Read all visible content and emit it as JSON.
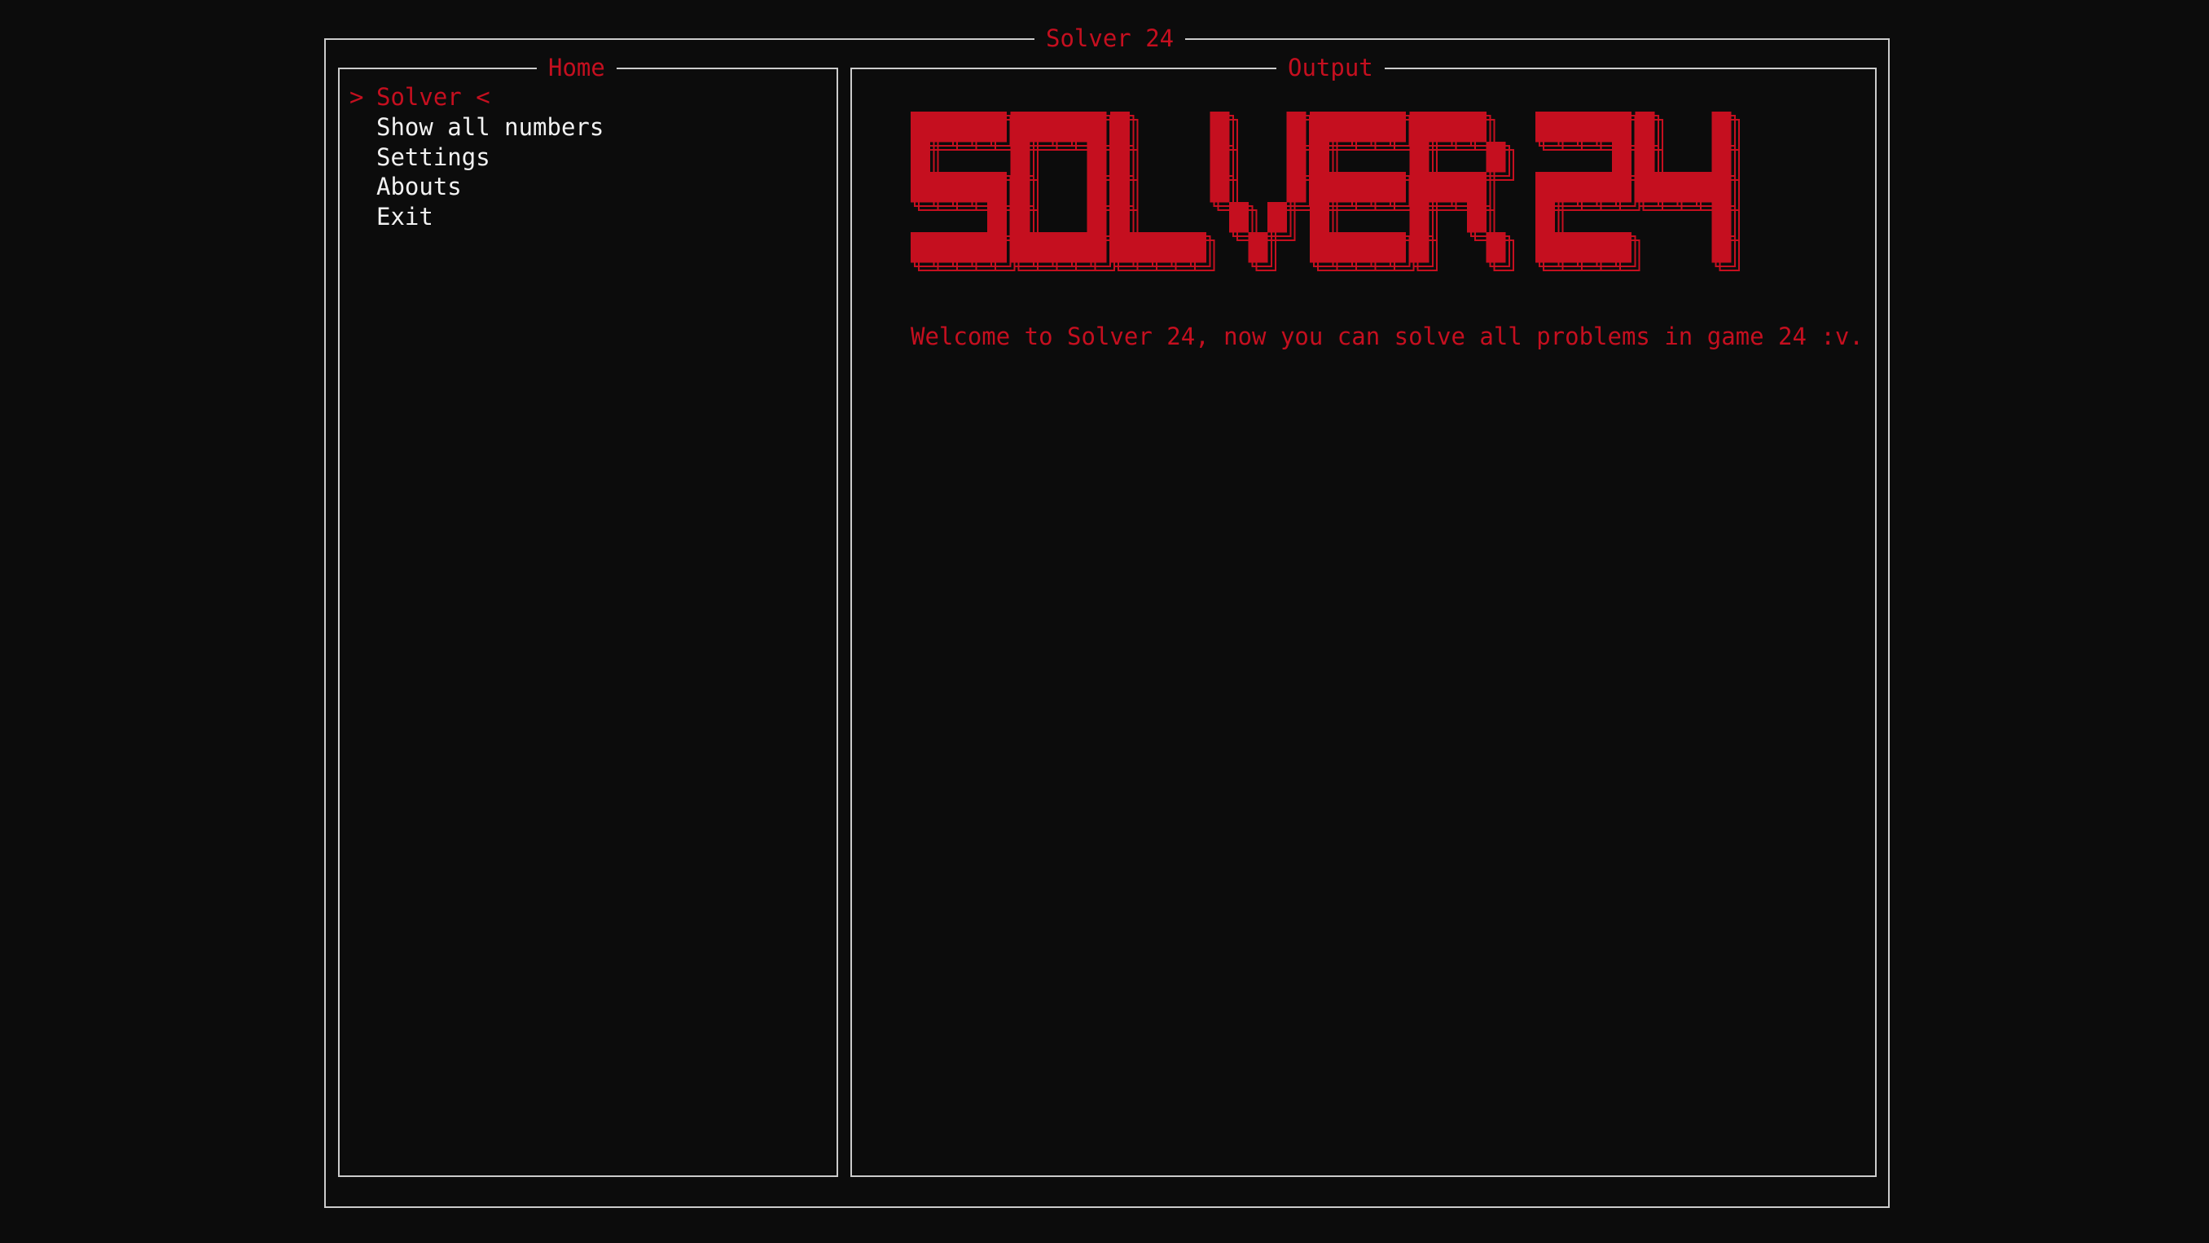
{
  "window": {
    "title": "Solver 24"
  },
  "home_pane": {
    "title": "Home",
    "selected_marker": ">",
    "selected_suffix": " <",
    "items": [
      {
        "label": "Solver",
        "selected": true
      },
      {
        "label": "Show all numbers",
        "selected": false
      },
      {
        "label": "Settings",
        "selected": false
      },
      {
        "label": "Abouts",
        "selected": false
      },
      {
        "label": "Exit",
        "selected": false
      }
    ]
  },
  "output_pane": {
    "title": "Output",
    "banner_text": "SOLVER 24",
    "welcome": "Welcome to Solver 24, now you can solve all problems in game 24 :v."
  },
  "colors": {
    "accent": "#c50f1f",
    "border": "#cccccc",
    "text": "#f2f2f2",
    "background": "#0c0c0c"
  }
}
